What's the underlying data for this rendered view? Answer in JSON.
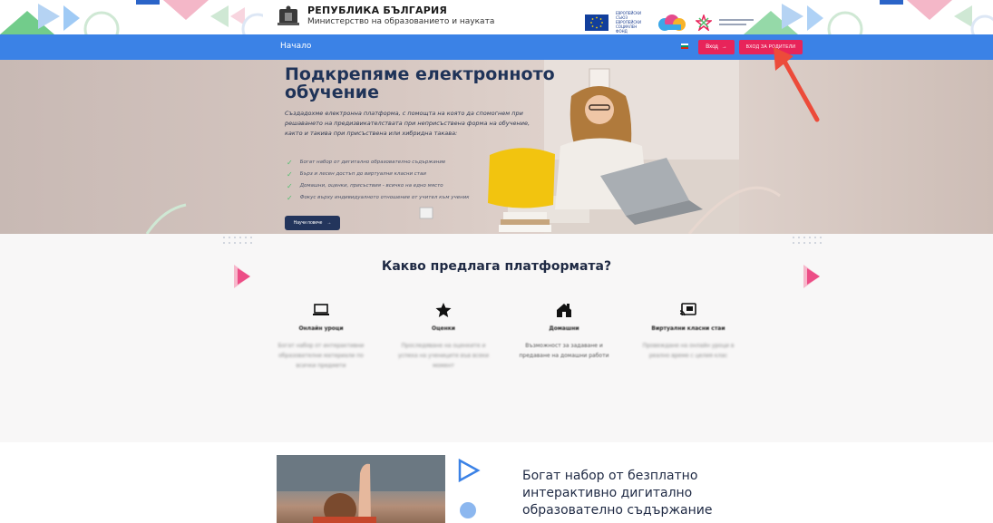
{
  "header": {
    "brand_title": "РЕПУБЛИКА БЪЛГАРИЯ",
    "brand_subtitle": "Министерство на образованието и науката",
    "eu_text": "ЕВРОПЕЙСКИ СЪЮЗ ЕВРОПЕЙСКИ СОЦИАЛЕН ФОНД"
  },
  "nav": {
    "home_label": "Начало",
    "login_label": "Вход",
    "parents_login_label": "ВХОД ЗА РОДИТЕЛИ"
  },
  "hero": {
    "title": "Подкрепяме електронното обучение",
    "description": "Създадохме електронна платформа, с помощта на която да спомогнем при решаването на предизвикателствата при неприсъствена форма на обучение, както и такива при присъствена или хибридна такава:",
    "bullets": [
      "Богат набор от дигитално образователно съдържание",
      "Бърз и лесен достъп до виртуални класни стаи",
      "Домашни, оценки, присъствия - всичко на едно място",
      "Фокус върху индивидуалното отношение от учител към ученик"
    ],
    "more_button": "Научи повече"
  },
  "features": {
    "title": "Какво предлага платформата?",
    "items": [
      {
        "icon": "laptop-icon",
        "name": "Онлайн уроци",
        "text": "Богат набор от интерактивни образователни материали по всички предмети"
      },
      {
        "icon": "star-icon",
        "name": "Оценки",
        "text": "Проследяване на оценките и успеха на учениците във всеки момент"
      },
      {
        "icon": "home-icon",
        "name": "Домашни",
        "text": "Възможност за задаване и предаване на домашни работи"
      },
      {
        "icon": "cast-icon",
        "name": "Виртуални класни стаи",
        "text": "Провеждане на онлайн уроци в реално време с целия клас"
      }
    ]
  },
  "lower": {
    "heading": "Богат набор от безплатно интерактивно дигитално образователно съдържание"
  },
  "colors": {
    "nav_blue": "#3b82e6",
    "accent_pink": "#e8245a",
    "navy": "#23355c",
    "check_green": "#4fbf6e"
  }
}
